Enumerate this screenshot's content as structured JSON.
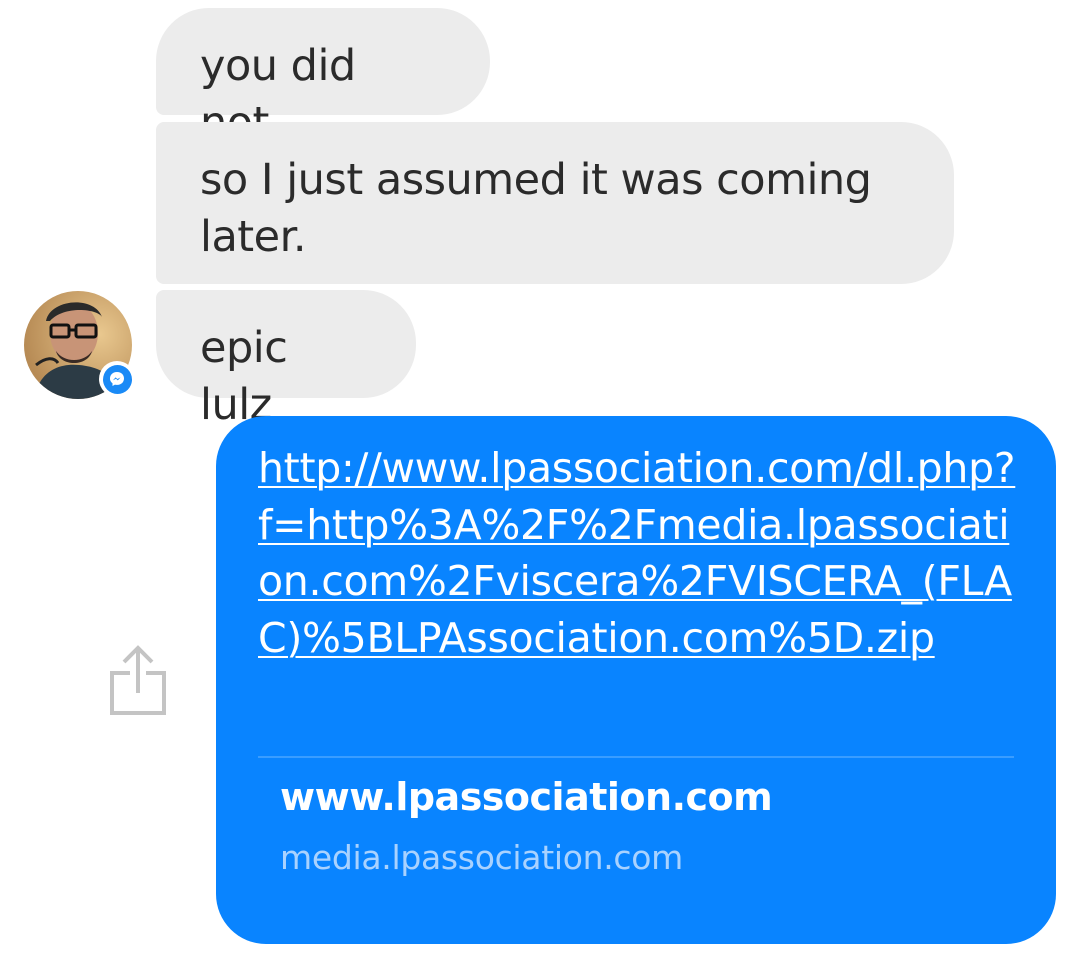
{
  "messages_incoming": [
    {
      "text": "you did not."
    },
    {
      "text": "so I just assumed it was coming later."
    },
    {
      "text": "epic lulz"
    }
  ],
  "message_outgoing": {
    "link_text": "http://www.lpassociation.com/dl.php?f=http%3A%2F%2Fmedia.lpassociation.com%2Fviscera%2FVISCERA_(FLAC)%5BLPAssociation.com%5D.zip",
    "preview": {
      "title": "www.lpassociation.com",
      "domain": "media.lpassociation.com"
    }
  },
  "icons": {
    "avatar": "avatar",
    "badge": "messenger-icon",
    "share": "share-icon"
  },
  "colors": {
    "incoming_bubble": "#ececec",
    "outgoing_bubble": "#0984ff",
    "messenger_badge": "#1a8af6"
  }
}
